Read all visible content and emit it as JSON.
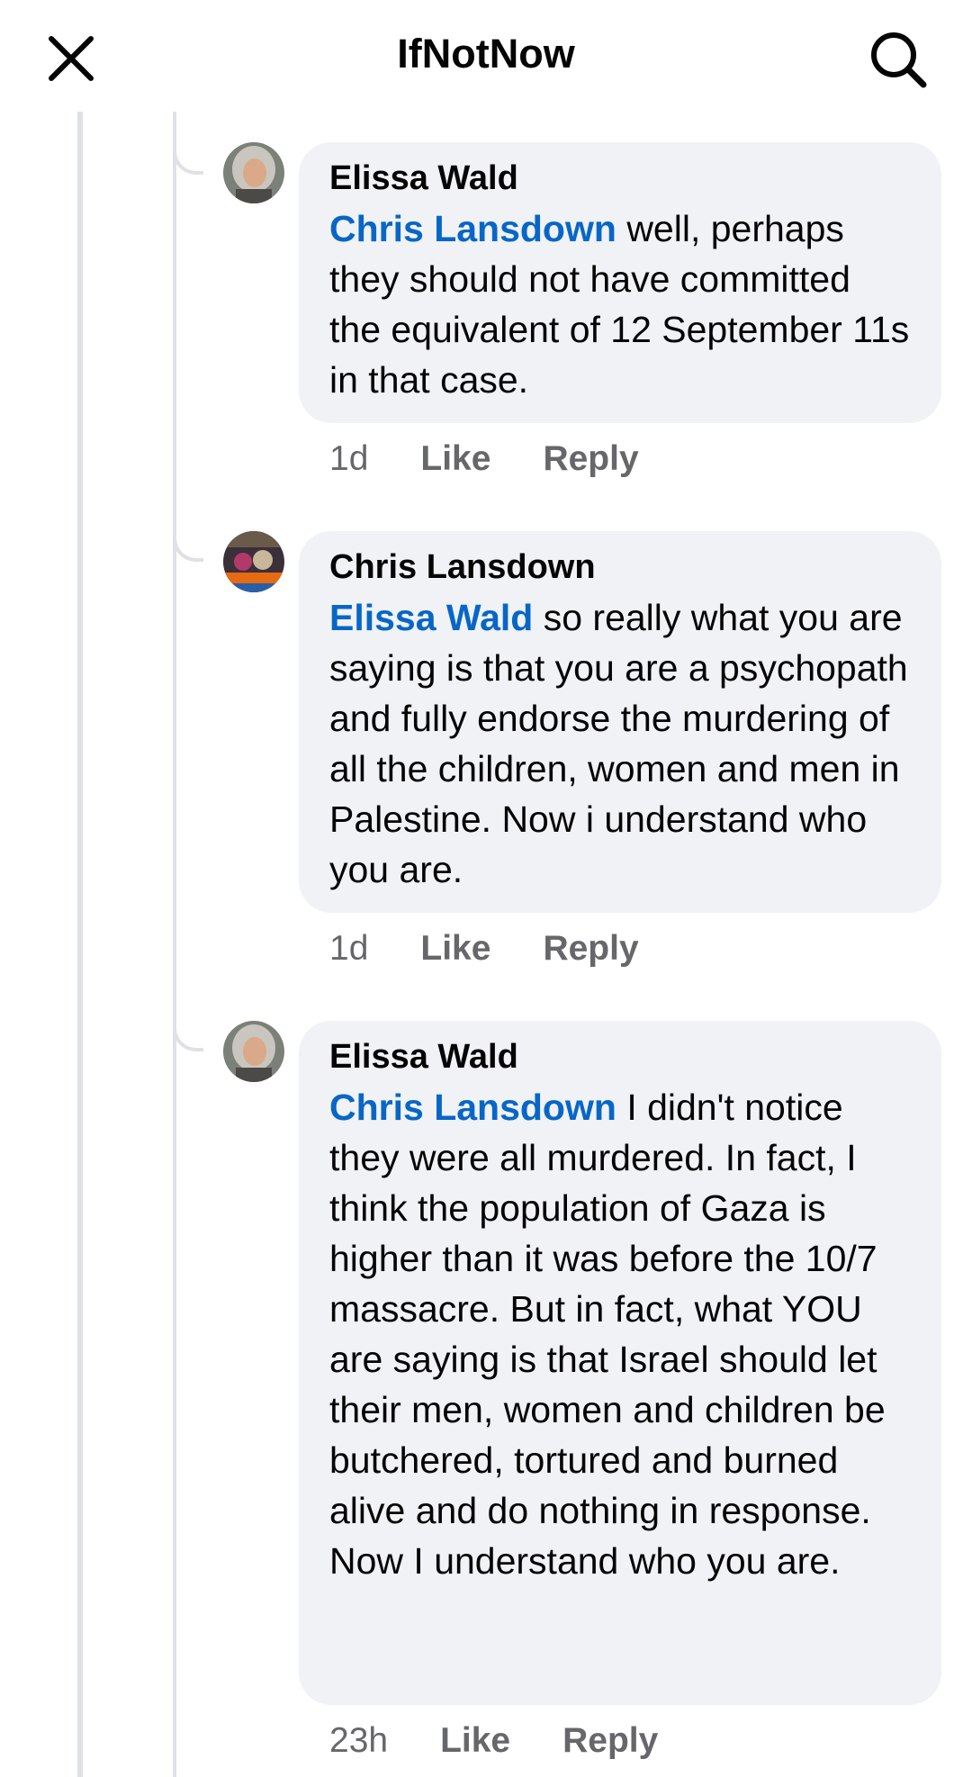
{
  "header": {
    "title": "IfNotNow",
    "close_icon": "close-icon",
    "search_icon": "search-icon"
  },
  "comments": [
    {
      "author": "Elissa Wald",
      "mention": "Chris Lansdown",
      "text": " well, perhaps they should not have committed the equivalent of 12 September 11s in that case.",
      "time": "1d",
      "like_label": "Like",
      "reply_label": "Reply"
    },
    {
      "author": "Chris Lansdown",
      "mention": "Elissa Wald",
      "text": " so really what you are saying is that you are a psychopath and fully endorse the murdering of all the children, women and men in Palestine. Now i understand who you are.",
      "time": "1d",
      "like_label": "Like",
      "reply_label": "Reply"
    },
    {
      "author": "Elissa Wald",
      "mention": "Chris Lansdown",
      "text": " I didn't notice they were all murdered. In fact, I think the population of Gaza is higher than it was before the 10/7 massacre. But in fact, what YOU are saying is that Israel should let their men, women and children be butchered, tortured and burned alive and do nothing in response. Now I understand who you are.",
      "time": "23h",
      "like_label": "Like",
      "reply_label": "Reply"
    }
  ],
  "colors": {
    "mention": "#0866c6",
    "bubble_bg": "#f0f2f5",
    "meta_text": "#65676b",
    "thread_line": "#dfe1e5"
  }
}
